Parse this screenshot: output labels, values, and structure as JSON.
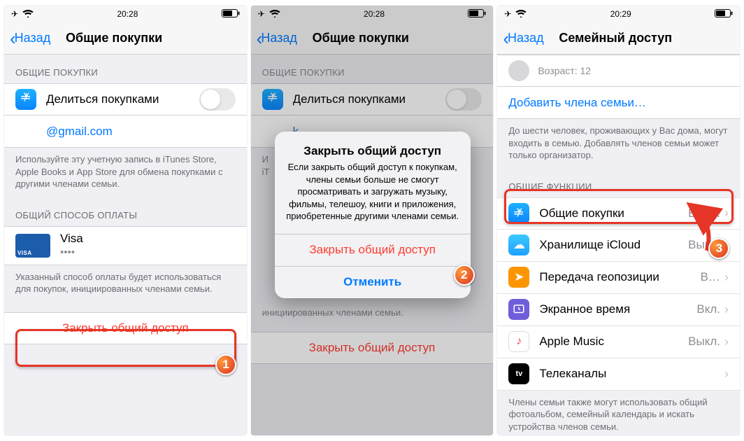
{
  "status": {
    "time1": "20:28",
    "time3": "20:29"
  },
  "nav": {
    "back": "Назад",
    "title_shared": "Общие покупки",
    "title_family": "Семейный доступ"
  },
  "screen1": {
    "section_shared": "ОБЩИЕ ПОКУПКИ",
    "share_label": "Делиться покупками",
    "email": "@gmail.com",
    "footer1": "Используйте эту учетную запись в iTunes Store, Apple Books и App Store для обмена покупками с другими членами семьи.",
    "section_payment": "ОБЩИЙ СПОСОБ ОПЛАТЫ",
    "card_brand": "Visa",
    "card_dots": "•••• ",
    "footer2": "Указанный способ оплаты будет использоваться для покупок, инициированных членами семьи.",
    "stop_sharing": "Закрыть общий доступ"
  },
  "screen2": {
    "modal_title": "Закрыть общий доступ",
    "modal_message": "Если закрыть общий доступ к покупкам, члены семьи больше не смогут просматривать и загружать музыку, фильмы, телешоу, книги и приложения, приобретенные другими членами семьи.",
    "modal_confirm": "Закрыть общий доступ",
    "modal_cancel": "Отменить",
    "bg_footer": "инициированных членами семьи.",
    "bg_stop": "Закрыть общий доступ"
  },
  "screen3": {
    "member_age": "Возраст: 12",
    "add_member": "Добавить члена семьи…",
    "footer_members": "До шести человек, проживающих у Вас дома, могут входить в семью. Добавлять членов семьи может только организатор.",
    "section_functions": "ОБЩИЕ ФУНКЦИИ",
    "features": [
      {
        "label": "Общие покупки",
        "detail": "Выкл."
      },
      {
        "label": "Хранилище iCloud",
        "detail": "Выкл."
      },
      {
        "label": "Передача геопозиции",
        "detail": "В…"
      },
      {
        "label": "Экранное время",
        "detail": "Вкл."
      },
      {
        "label": "Apple Music",
        "detail": "Выкл."
      },
      {
        "label": "Телеканалы",
        "detail": ""
      }
    ],
    "footer_features": "Члены семьи также могут использовать общий фотоальбом, семейный календарь и искать устройства членов семьи."
  },
  "badges": {
    "b1": "1",
    "b2": "2",
    "b3": "3"
  }
}
